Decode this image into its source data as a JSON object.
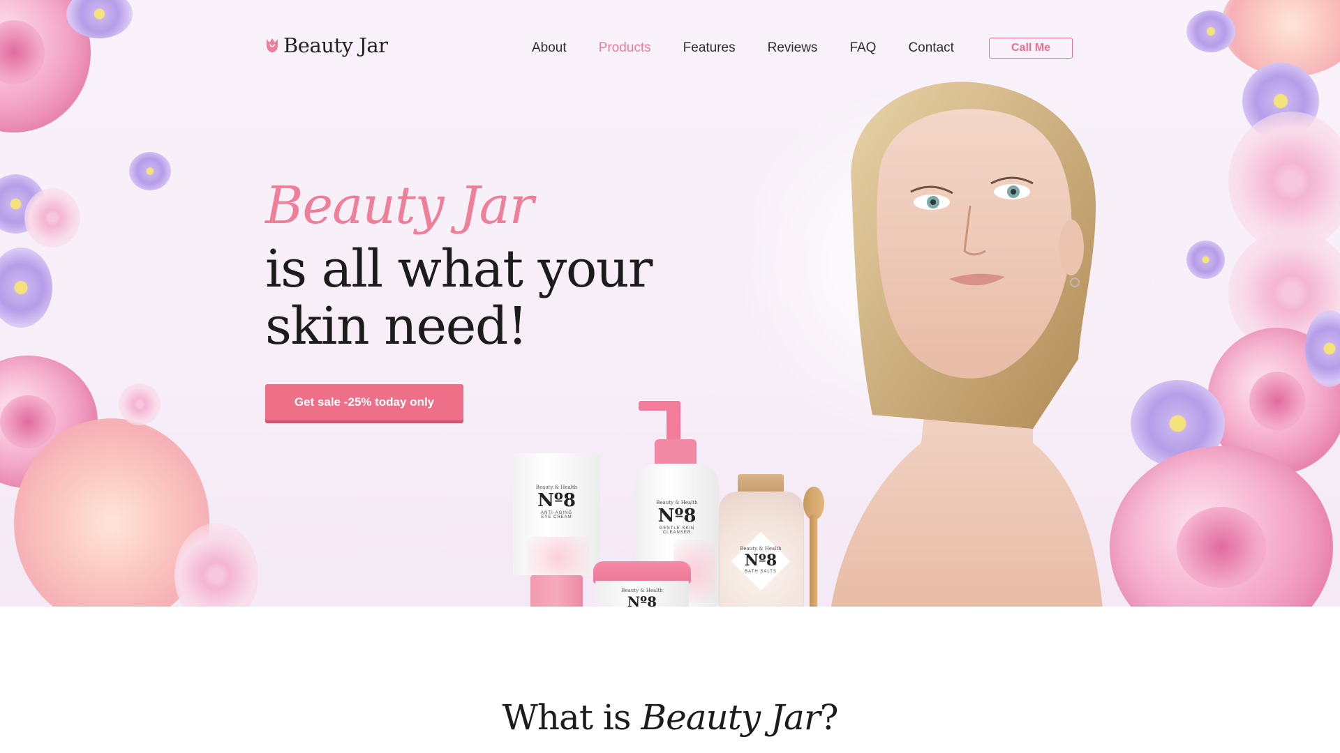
{
  "header": {
    "logo_text": "Beauty Jar",
    "nav": [
      {
        "label": "About",
        "active": false
      },
      {
        "label": "Products",
        "active": true
      },
      {
        "label": "Features",
        "active": false
      },
      {
        "label": "Reviews",
        "active": false
      },
      {
        "label": "FAQ",
        "active": false
      },
      {
        "label": "Contact",
        "active": false
      }
    ],
    "cta_label": "Call Me"
  },
  "hero": {
    "brand_script": "Beauty Jar",
    "headline_line1": "is all what your",
    "headline_line2": "skin need!",
    "sale_button": "Get sale -25% today only"
  },
  "products": [
    {
      "brand": "Beauty & Health",
      "number": "Nº8",
      "name_line1": "ANTI-AGING",
      "name_line2": "EYE CREAM"
    },
    {
      "brand": "Beauty & Health",
      "number": "Nº8",
      "name_line1": "GENTLE SKIN",
      "name_line2": "CLEANSER"
    },
    {
      "brand": "Beauty & Health",
      "number": "Nº8",
      "name_line1": "",
      "name_line2": ""
    },
    {
      "brand": "Beauty & Health",
      "number": "Nº8",
      "name_line1": "BATH SALTS",
      "name_line2": ""
    }
  ],
  "section": {
    "title_plain": "What is ",
    "title_italic": "Beauty Jar",
    "title_end": "?"
  },
  "colors": {
    "accent": "#ee6f88",
    "nav_active": "#ea7c9a",
    "hero_bg": "#f8f0f9"
  }
}
